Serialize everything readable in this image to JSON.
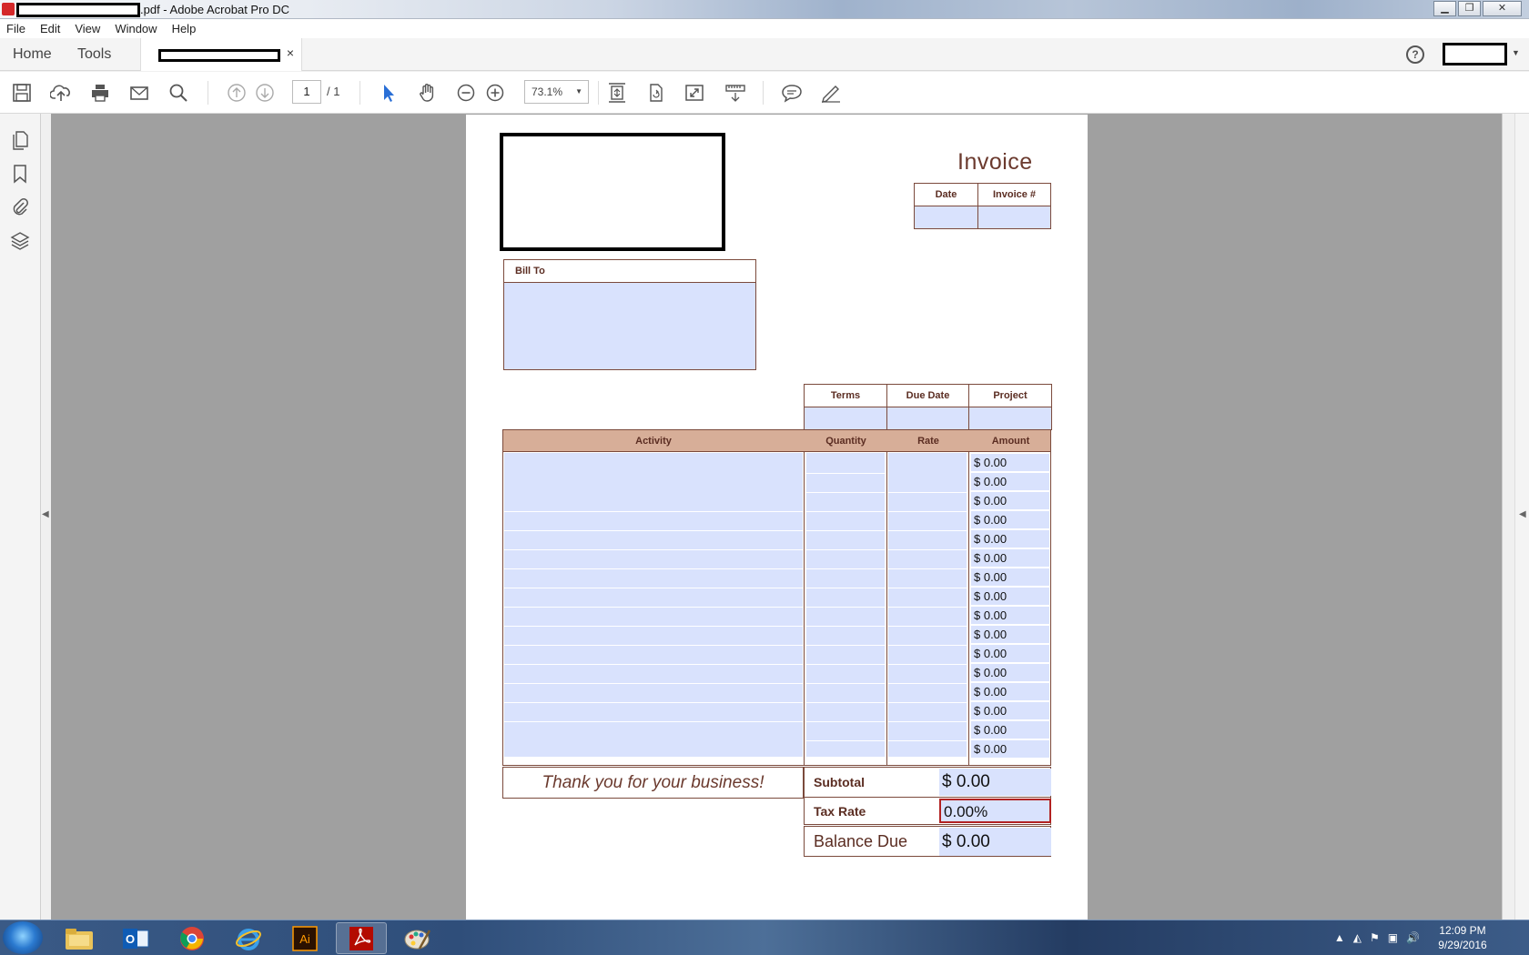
{
  "window": {
    "title_suffix": ".pdf - Adobe Acrobat Pro DC",
    "minimize": "▁",
    "restore": "❐",
    "close": "✕"
  },
  "menu": [
    "File",
    "Edit",
    "View",
    "Window",
    "Help"
  ],
  "nav": {
    "home": "Home",
    "tools": "Tools",
    "tab_close": "×",
    "help": "?"
  },
  "toolbar": {
    "page_current": "1",
    "page_total": "/ 1",
    "zoom": "73.1%"
  },
  "invoice": {
    "title": "Invoice",
    "date_label": "Date",
    "invoice_no_label": "Invoice #",
    "bill_to_label": "Bill To",
    "terms_label": "Terms",
    "due_date_label": "Due Date",
    "project_label": "Project",
    "columns": [
      "Activity",
      "Quantity",
      "Rate",
      "Amount"
    ],
    "amounts": [
      "$ 0.00",
      "$ 0.00",
      "$ 0.00",
      "$ 0.00",
      "$ 0.00",
      "$ 0.00",
      "$ 0.00",
      "$ 0.00",
      "$ 0.00",
      "$ 0.00",
      "$ 0.00",
      "$ 0.00",
      "$ 0.00",
      "$ 0.00",
      "$ 0.00",
      "$ 0.00"
    ],
    "thanks": "Thank you for your business!",
    "subtotal_label": "Subtotal",
    "subtotal_value": "$ 0.00",
    "tax_label": "Tax Rate",
    "tax_value": "0.00%",
    "balance_label": "Balance Due",
    "balance_value": "$ 0.00"
  },
  "taskbar": {
    "time": "12:09 PM",
    "date": "9/29/2016",
    "apps": [
      "file-explorer",
      "outlook",
      "chrome",
      "internet-explorer",
      "illustrator",
      "acrobat",
      "paint"
    ],
    "illustrator_label": "Ai"
  },
  "colors": {
    "accent_brown": "#6b3a2e",
    "header_fill": "#d7ae98",
    "form_field_fill": "#d9e2fd",
    "tax_field_border": "#b22222"
  }
}
